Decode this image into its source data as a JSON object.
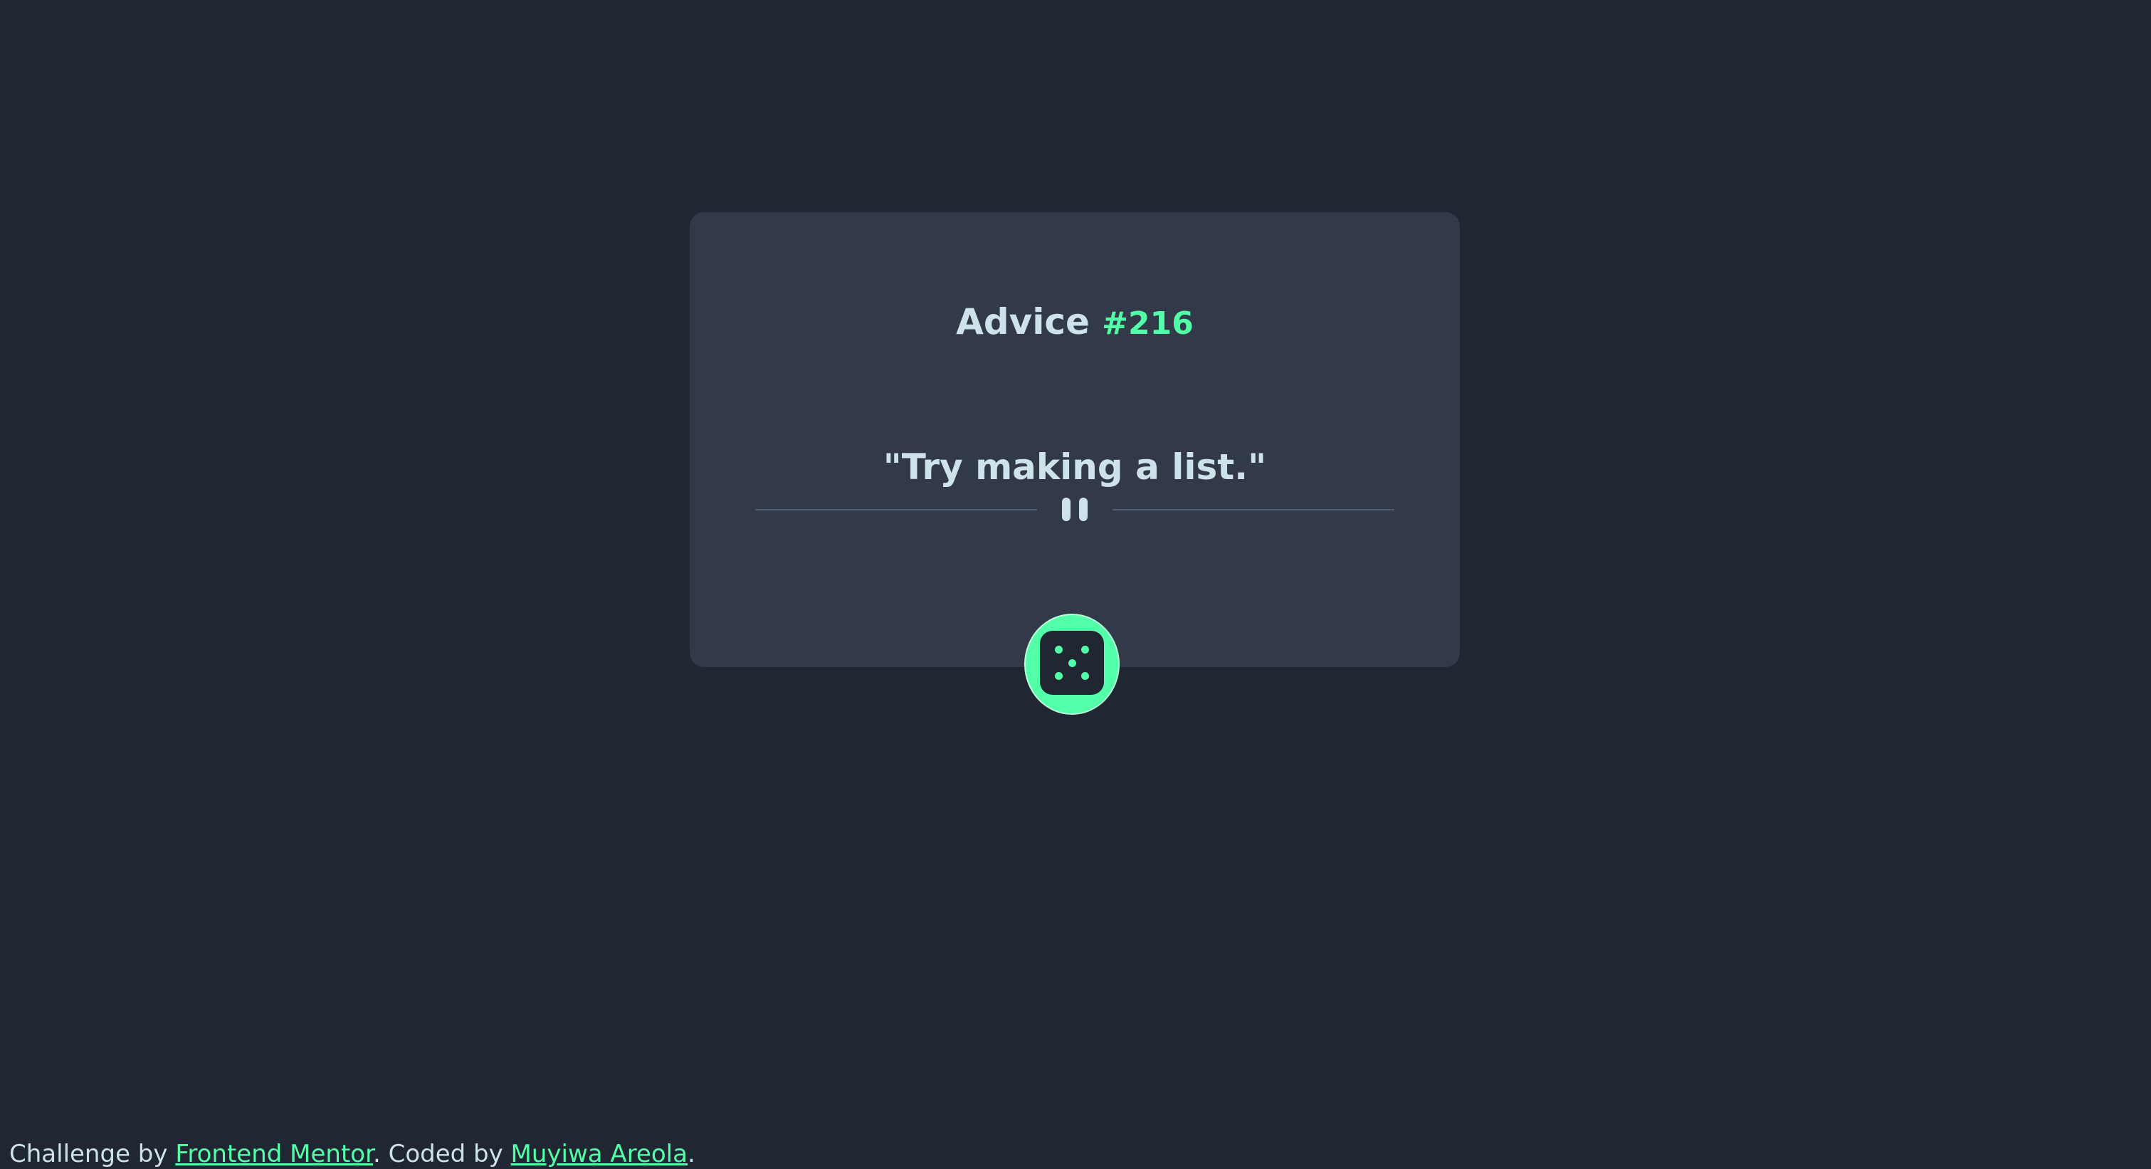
{
  "advice": {
    "label": "Advice",
    "number": "#216",
    "quote": "\"Try making a list.\""
  },
  "divider": {
    "icon": "pause-icon"
  },
  "dice_button": {
    "icon": "dice-five-icon"
  },
  "footer": {
    "prefix": "Challenge by",
    "challenge_link": "Frontend Mentor",
    "middle": ". Coded by",
    "author_link": "Muyiwa Areola",
    "suffix": "."
  },
  "colors": {
    "background": "#202632",
    "card": "#323a49",
    "text": "#cee3e9",
    "accent": "#52ffa8",
    "divider": "#4f5d74"
  }
}
